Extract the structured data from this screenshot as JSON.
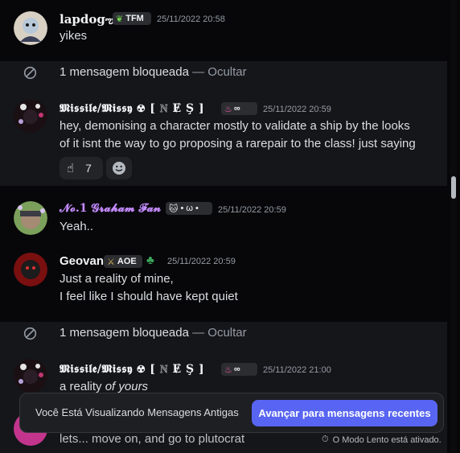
{
  "messages": [
    {
      "author": "lapdog",
      "author_suffix": "ఌ",
      "tag": "TFM",
      "timestamp": "25/11/2022 20:58",
      "lines": [
        "yikes"
      ]
    },
    {
      "blocked_text": "1 mensagem bloqueada",
      "blocked_sep": " — ",
      "blocked_action": "Ocultar"
    },
    {
      "author": "𝕸𝖎𝖘𝖘𝖎𝖑𝖊/𝕸𝖎𝖘𝖘𝖞 ☢ [ ℕ Ɇ Ş ]",
      "tag": "∞",
      "timestamp": "25/11/2022 20:59",
      "lines": [
        "hey, demonising a character mostly to validate a ship by the looks",
        "of it isnt the way to go proposing a rarepair to the class! just saying"
      ],
      "reaction_count": "7"
    },
    {
      "author": "𝓝𝓸.1 𝓖𝓻𝓪𝓱𝓪𝓶 𝓕𝓪𝓷",
      "tag": "• ω •",
      "timestamp": "25/11/2022 20:59",
      "lines": [
        "Yeah.."
      ]
    },
    {
      "author": "Geovan",
      "tag": "AOE",
      "timestamp": "25/11/2022 20:59",
      "lines": [
        "Just a reality of mine,",
        "I feel like I should have kept quiet"
      ]
    },
    {
      "blocked_text": "1 mensagem bloqueada",
      "blocked_sep": " — ",
      "blocked_action": "Ocultar"
    },
    {
      "author": "𝕸𝖎𝖘𝖘𝖎𝖑𝖊/𝕸𝖎𝖘𝖘𝖞 ☢ [ ℕ Ɇ Ş ]",
      "tag": "∞",
      "timestamp": "25/11/2022 21:00",
      "text_plain": "a reality ",
      "text_italic": "of yours"
    },
    {
      "partial_text": "lets... move on, and go to plutocrat"
    }
  ],
  "banner": {
    "text": "Você Está Visualizando Mensagens Antigas",
    "button": "Avançar para mensagens recentes"
  },
  "slowmode": {
    "text": "O Modo Lento está ativado."
  },
  "colors": {
    "background": "#070709",
    "blocked_band": "#15161a",
    "accent": "#5865f2",
    "graham_name": "#c48bff",
    "muted": "#949ba4"
  }
}
